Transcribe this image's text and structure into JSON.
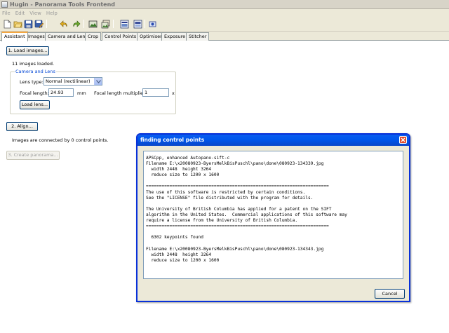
{
  "window": {
    "title": "Hugin - Panorama Tools Frontend"
  },
  "menu": {
    "items": [
      "File",
      "Edit",
      "View",
      "Help"
    ]
  },
  "toolbar": {
    "buttons": [
      "new-icon",
      "open-icon",
      "save-icon",
      "save-as-icon",
      "undo-icon",
      "redo-icon",
      "add-images-icon",
      "add-time-series-icon",
      "preview-icon",
      "fast-preview-icon",
      "optimize-icon"
    ]
  },
  "tabs": [
    "Assistant",
    "Images",
    "Camera and Lens",
    "Crop",
    "Control Points",
    "Optimiser",
    "Exposure",
    "Stitcher"
  ],
  "assistant": {
    "load_images_label": "1. Load images...",
    "images_loaded": "11 images loaded.",
    "camera_group_label": "Camera and Lens",
    "lens_type_label": "Lens type:",
    "lens_type_value": "Normal (rectilinear)",
    "focal_length_label": "Focal length:",
    "focal_length_value": "24.93",
    "focal_length_unit": "mm",
    "multiplier_label": "Focal length multiplier:",
    "multiplier_value": "1",
    "multiplier_unit": "x",
    "load_lens_label": "Load lens...",
    "align_label": "2. Align...",
    "control_points_status": "Images are connected by 0 control points.",
    "create_panorama_label": "3. Create panorama..."
  },
  "dialog": {
    "title": "finding control points",
    "log_lines": [
      "APSCpp, enhanced Autopano-sift-c",
      "Filename E:\\x20080923-ByersMelkBisPuschl\\pano\\done\\080923-134339.jpg",
      "  width 2448  height 3264",
      "  reduce size to 1200 x 1600",
      "",
      "======================================================================",
      "The use of this software is restricted by certain conditions.",
      "See the \"LICENSE\" file distributed with the program for details.",
      "",
      "The University of British Columbia has applied for a patent on the SIFT",
      "algorithm in the United States.  Commercial applications of this software may",
      "require a license from the University of British Columbia.",
      "======================================================================",
      "",
      "  6302 keypoints found",
      "",
      "Filename E:\\x20080923-ByersMelkBisPuschl\\pano\\done\\080923-134343.jpg",
      "  width 2448  height 3264",
      "  reduce size to 1200 x 1600"
    ],
    "cancel_label": "Cancel"
  }
}
